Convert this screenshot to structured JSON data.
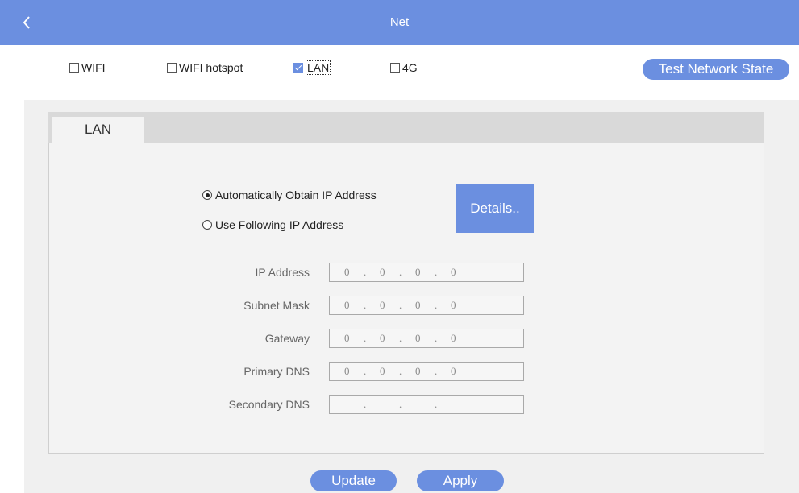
{
  "header": {
    "title": "Net",
    "back_icon": "chevron-left-icon"
  },
  "network_types": [
    {
      "label": "WIFI",
      "checked": false
    },
    {
      "label": "WIFI hotspot",
      "checked": false
    },
    {
      "label": "LAN",
      "checked": true
    },
    {
      "label": "4G",
      "checked": false
    }
  ],
  "test_button": "Test Network State",
  "tabs": [
    {
      "label": "LAN",
      "active": true
    }
  ],
  "ip_mode": {
    "auto_label": "Automatically Obtain IP Address",
    "manual_label": "Use Following IP Address",
    "selected": "auto"
  },
  "details_button": "Details..",
  "fields": [
    {
      "label": "IP Address",
      "octets": [
        "0",
        "0",
        "0",
        "0"
      ]
    },
    {
      "label": "Subnet Mask",
      "octets": [
        "0",
        "0",
        "0",
        "0"
      ]
    },
    {
      "label": "Gateway",
      "octets": [
        "0",
        "0",
        "0",
        "0"
      ]
    },
    {
      "label": "Primary DNS",
      "octets": [
        "0",
        "0",
        "0",
        "0"
      ]
    },
    {
      "label": "Secondary DNS",
      "octets": [
        "",
        "",
        "",
        ""
      ]
    }
  ],
  "ip_separator": ".",
  "buttons": {
    "update": "Update",
    "apply": "Apply"
  },
  "colors": {
    "accent": "#6b8fe0",
    "panel": "#f0f0f0",
    "tab_strip": "#d9d9d9"
  }
}
